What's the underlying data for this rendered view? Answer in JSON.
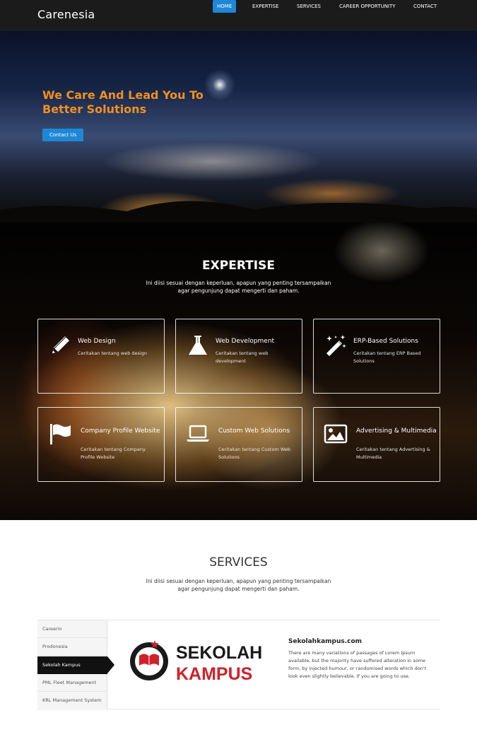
{
  "navbar": {
    "brand": "Carenesia",
    "items": [
      {
        "label": "HOME",
        "active": true
      },
      {
        "label": "EXPERTISE",
        "active": false
      },
      {
        "label": "SERVICES",
        "active": false
      },
      {
        "label": "CAREER OPPORTUNITY",
        "active": false
      },
      {
        "label": "CONTACT",
        "active": false
      }
    ]
  },
  "hero": {
    "title_line1": "We Care And Lead You To",
    "title_line2": "Better Solutions",
    "button_label": "Contact Us"
  },
  "expertise": {
    "title": "EXPERTISE",
    "subtitle_line1": "Ini diisi sesuai dengan keperluan, apapun yang penting tersampaikan",
    "subtitle_line2": "agar pengunjung dapat mengerti dan paham.",
    "cards": [
      {
        "title": "Web Design",
        "desc": "Ceritakan tentang web design",
        "icon": "pencil-icon"
      },
      {
        "title": "Web Development",
        "desc": "Ceritakan tentang web development",
        "icon": "flask-icon"
      },
      {
        "title": "ERP-Based Solutions",
        "desc": "Ceritakan tentang ERP Based Solutions",
        "icon": "magic-wand-icon"
      },
      {
        "title": "Company Profile Website",
        "desc": "Ceritakan tentang Company Profile Website",
        "icon": "flag-icon"
      },
      {
        "title": "Custom Web Solutions",
        "desc": "Ceritakan tentang Custom Web Solutions",
        "icon": "laptop-icon"
      },
      {
        "title": "Advertising & Multimedia",
        "desc": "Ceritakan tentang Advertising & Multimedia",
        "icon": "picture-icon"
      }
    ]
  },
  "services": {
    "title": "SERVICES",
    "subtitle_line1": "Ini diisi sesuai dengan keperluan, apapun yang penting tersampaikan",
    "subtitle_line2": "agar pengunjung dapat mengerti dan paham.",
    "tabs": [
      {
        "label": "Careerin",
        "active": false
      },
      {
        "label": "Prodonesia",
        "active": false
      },
      {
        "label": "Sekolah Kampus",
        "active": true
      },
      {
        "label": "PML Fleet Management",
        "active": false
      },
      {
        "label": "KRL Management System",
        "active": false
      }
    ],
    "detail": {
      "logo_line1": "SEKOLAH",
      "logo_line2": "KAMPUS",
      "title": "Sekolahkampus.com",
      "desc": "There are many variations of passages of Lorem Ipsum available, but the majority have suffered alteration in some form, by injected humour, or randomised words which don't look even slightly believable. If you are going to use."
    }
  },
  "colors": {
    "accent_blue": "#1e88d6",
    "hero_title_orange": "#f0901e",
    "navbar_bg": "#1b1b1b",
    "logo_red": "#d0202a"
  }
}
